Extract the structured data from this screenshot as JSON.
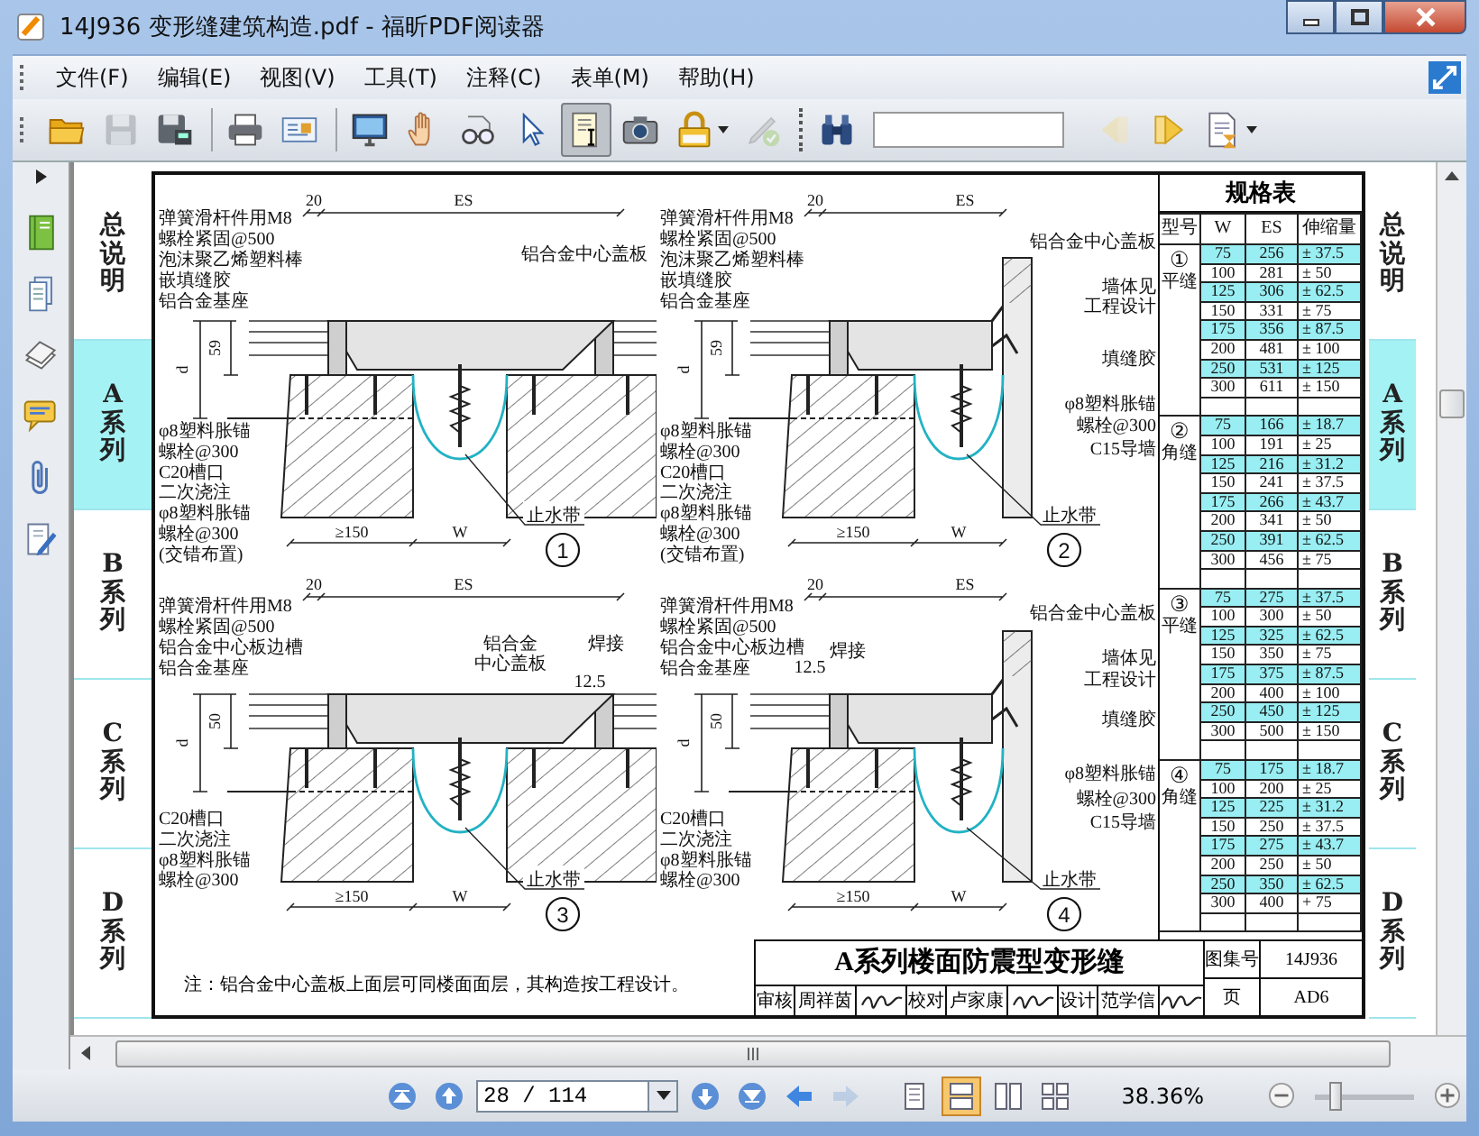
{
  "window": {
    "title": "14J936 变形缝建筑构造.pdf - 福昕PDF阅读器"
  },
  "menu": [
    "文件(F)",
    "编辑(E)",
    "视图(V)",
    "工具(T)",
    "注释(C)",
    "表单(M)",
    "帮助(H)"
  ],
  "toolbar": {
    "tools": [
      {
        "selected": false,
        "disabled": false
      },
      {
        "selected": false,
        "disabled": true
      },
      {
        "selected": false,
        "disabled": false
      },
      {
        "selected": false,
        "disabled": false
      },
      {
        "selected": false,
        "disabled": false
      },
      {
        "selected": false,
        "disabled": false
      },
      {
        "selected": false,
        "disabled": false
      },
      {
        "selected": false,
        "disabled": false
      },
      {
        "selected": false,
        "disabled": false
      },
      {
        "selected": true,
        "disabled": false
      },
      {
        "selected": false,
        "disabled": false
      },
      {
        "selected": false,
        "disabled": false
      },
      {
        "selected": false,
        "disabled": true
      },
      {
        "selected": false,
        "disabled": false
      },
      {
        "selected": false,
        "disabled": true
      },
      {
        "selected": false,
        "disabled": false
      },
      {
        "selected": false,
        "disabled": false
      }
    ]
  },
  "page": {
    "left_tabs": [
      {
        "label": "总说明",
        "selected": false
      },
      {
        "label": "A系列",
        "selected": true
      },
      {
        "label": "B系列",
        "selected": false
      },
      {
        "label": "C系列",
        "selected": false
      },
      {
        "label": "D系列",
        "selected": false
      }
    ],
    "panels": [
      {
        "kind": "flat",
        "number": "1",
        "dims": {
          "top_small": "20",
          "top": "ES",
          "height_small": "59",
          "height": "d",
          "bottom_left": "≥150",
          "bottom": "W"
        },
        "top_labels": [
          "弹簧滑杆件用M8",
          "螺栓紧固@500",
          "泡沫聚乙烯塑料棒",
          "嵌填缝胶",
          "铝合金基座"
        ],
        "callouts": [
          "铝合金中心盖板"
        ],
        "bottom_labels": [
          "φ8塑料胀锚",
          "螺栓@300",
          "C20槽口",
          "二次浇注",
          "φ8塑料胀锚",
          "螺栓@300",
          "(交错布置)"
        ],
        "waterstop": "止水带"
      },
      {
        "kind": "corner",
        "number": "2",
        "dims": {
          "top_small": "20",
          "top": "ES",
          "height_small": "59",
          "height": "d",
          "bottom_left": "≥150",
          "bottom": "W"
        },
        "top_labels": [
          "弹簧滑杆件用M8",
          "螺栓紧固@500",
          "泡沫聚乙烯塑料棒",
          "嵌填缝胶",
          "铝合金基座"
        ],
        "side_labels": [
          "铝合金中心盖板",
          "墙体见",
          "工程设计",
          "填缝胶",
          "φ8塑料胀锚",
          "螺栓@300",
          "C15导墙"
        ],
        "bottom_labels": [
          "φ8塑料胀锚",
          "螺栓@300",
          "C20槽口",
          "二次浇注",
          "φ8塑料胀锚",
          "螺栓@300",
          "(交错布置)"
        ],
        "waterstop": "止水带"
      },
      {
        "kind": "flat",
        "number": "3",
        "dims": {
          "top_small": "20",
          "top": "ES",
          "height_small": "50",
          "height": "d",
          "bottom_left": "≥150",
          "bottom": "W"
        },
        "top_labels": [
          "弹簧滑杆件用M8",
          "螺栓紧固@500",
          "铝合金中心板边槽",
          "铝合金基座"
        ],
        "callouts": [
          "铝合金",
          "中心盖板",
          "焊接",
          "12.5"
        ],
        "bottom_labels": [
          "C20槽口",
          "二次浇注",
          "φ8塑料胀锚",
          "螺栓@300"
        ],
        "waterstop": "止水带"
      },
      {
        "kind": "corner",
        "number": "4",
        "dims": {
          "top_small": "20",
          "top": "ES",
          "height_small": "50",
          "height": "d",
          "bottom_left": "≥150",
          "bottom": "W"
        },
        "top_labels": [
          "弹簧滑杆件用M8",
          "螺栓紧固@500",
          "铝合金中心板边槽",
          "铝合金基座"
        ],
        "callouts": [
          "焊接",
          "12.5"
        ],
        "side_labels": [
          "铝合金中心盖板",
          "墙体见",
          "工程设计",
          "填缝胶",
          "φ8塑料胀锚",
          "螺栓@300",
          "C15导墙"
        ],
        "bottom_labels": [
          "C20槽口",
          "二次浇注",
          "φ8塑料胀锚",
          "螺栓@300"
        ],
        "waterstop": "止水带"
      }
    ],
    "spec_table": {
      "title": "规格表",
      "columns": [
        "型号",
        "W",
        "ES",
        "伸缩量"
      ],
      "groups": [
        {
          "number": "①",
          "type": "平缝",
          "rows": [
            {
              "w": "75",
              "es": "256",
              "range": "± 37.5",
              "highlighted": true
            },
            {
              "w": "100",
              "es": "281",
              "range": "± 50",
              "highlighted": false
            },
            {
              "w": "125",
              "es": "306",
              "range": "± 62.5",
              "highlighted": true
            },
            {
              "w": "150",
              "es": "331",
              "range": "± 75",
              "highlighted": false
            },
            {
              "w": "175",
              "es": "356",
              "range": "± 87.5",
              "highlighted": true
            },
            {
              "w": "200",
              "es": "481",
              "range": "± 100",
              "highlighted": false
            },
            {
              "w": "250",
              "es": "531",
              "range": "± 125",
              "highlighted": true
            },
            {
              "w": "300",
              "es": "611",
              "range": "± 150",
              "highlighted": false
            }
          ]
        },
        {
          "number": "②",
          "type": "角缝",
          "rows": [
            {
              "w": "75",
              "es": "166",
              "range": "± 18.7",
              "highlighted": true
            },
            {
              "w": "100",
              "es": "191",
              "range": "± 25",
              "highlighted": false
            },
            {
              "w": "125",
              "es": "216",
              "range": "± 31.2",
              "highlighted": true
            },
            {
              "w": "150",
              "es": "241",
              "range": "± 37.5",
              "highlighted": false
            },
            {
              "w": "175",
              "es": "266",
              "range": "± 43.7",
              "highlighted": true
            },
            {
              "w": "200",
              "es": "341",
              "range": "± 50",
              "highlighted": false
            },
            {
              "w": "250",
              "es": "391",
              "range": "± 62.5",
              "highlighted": true
            },
            {
              "w": "300",
              "es": "456",
              "range": "± 75",
              "highlighted": false
            }
          ]
        },
        {
          "number": "③",
          "type": "平缝",
          "rows": [
            {
              "w": "75",
              "es": "275",
              "range": "± 37.5",
              "highlighted": true
            },
            {
              "w": "100",
              "es": "300",
              "range": "± 50",
              "highlighted": false
            },
            {
              "w": "125",
              "es": "325",
              "range": "± 62.5",
              "highlighted": true
            },
            {
              "w": "150",
              "es": "350",
              "range": "± 75",
              "highlighted": false
            },
            {
              "w": "175",
              "es": "375",
              "range": "± 87.5",
              "highlighted": true
            },
            {
              "w": "200",
              "es": "400",
              "range": "± 100",
              "highlighted": false
            },
            {
              "w": "250",
              "es": "450",
              "range": "± 125",
              "highlighted": true
            },
            {
              "w": "300",
              "es": "500",
              "range": "± 150",
              "highlighted": false
            }
          ]
        },
        {
          "number": "④",
          "type": "角缝",
          "rows": [
            {
              "w": "75",
              "es": "175",
              "range": "± 18.7",
              "highlighted": true
            },
            {
              "w": "100",
              "es": "200",
              "range": "± 25",
              "highlighted": false
            },
            {
              "w": "125",
              "es": "225",
              "range": "± 31.2",
              "highlighted": true
            },
            {
              "w": "150",
              "es": "250",
              "range": "± 37.5",
              "highlighted": false
            },
            {
              "w": "175",
              "es": "275",
              "range": "± 43.7",
              "highlighted": true
            },
            {
              "w": "200",
              "es": "250",
              "range": "± 50",
              "highlighted": false
            },
            {
              "w": "250",
              "es": "350",
              "range": "± 62.5",
              "highlighted": true
            },
            {
              "w": "300",
              "es": "400",
              "range": "+ 75",
              "highlighted": false
            }
          ]
        }
      ]
    },
    "note": "注：铝合金中心盖板上面层可同楼面面层，其构造按工程设计。",
    "title_block": {
      "title": "A系列楼面防震型变形缝",
      "sign_row": [
        {
          "kind": "label",
          "text": "审核"
        },
        {
          "kind": "name",
          "text": "周祥茵"
        },
        {
          "kind": "signature"
        },
        {
          "kind": "label",
          "text": "校对"
        },
        {
          "kind": "name",
          "text": "卢家康"
        },
        {
          "kind": "signature"
        },
        {
          "kind": "label",
          "text": "设计"
        },
        {
          "kind": "name",
          "text": "范学信"
        },
        {
          "kind": "signature"
        }
      ],
      "atlas_label": "图集号",
      "atlas_number": "14J936",
      "page_label": "页",
      "page_number": "AD6"
    },
    "right_tabs": [
      {
        "label": "总说明",
        "selected": false
      },
      {
        "label": "A系列",
        "selected": true
      },
      {
        "label": "B系列",
        "selected": false
      },
      {
        "label": "C系列",
        "selected": false
      },
      {
        "label": "D系列",
        "selected": false
      }
    ]
  },
  "status_bar": {
    "nav_buttons": [
      {
        "disabled": false
      },
      {
        "disabled": false
      },
      {
        "disabled": false
      },
      {
        "disabled": false
      },
      {
        "disabled": false
      },
      {
        "disabled": true
      }
    ],
    "page_field": "28 / 114",
    "view_modes": [
      {
        "selected": false
      },
      {
        "selected": true
      },
      {
        "selected": false
      },
      {
        "selected": false
      }
    ],
    "zoom": "38.36%",
    "zoom_slider": {
      "level": 0.2
    }
  }
}
